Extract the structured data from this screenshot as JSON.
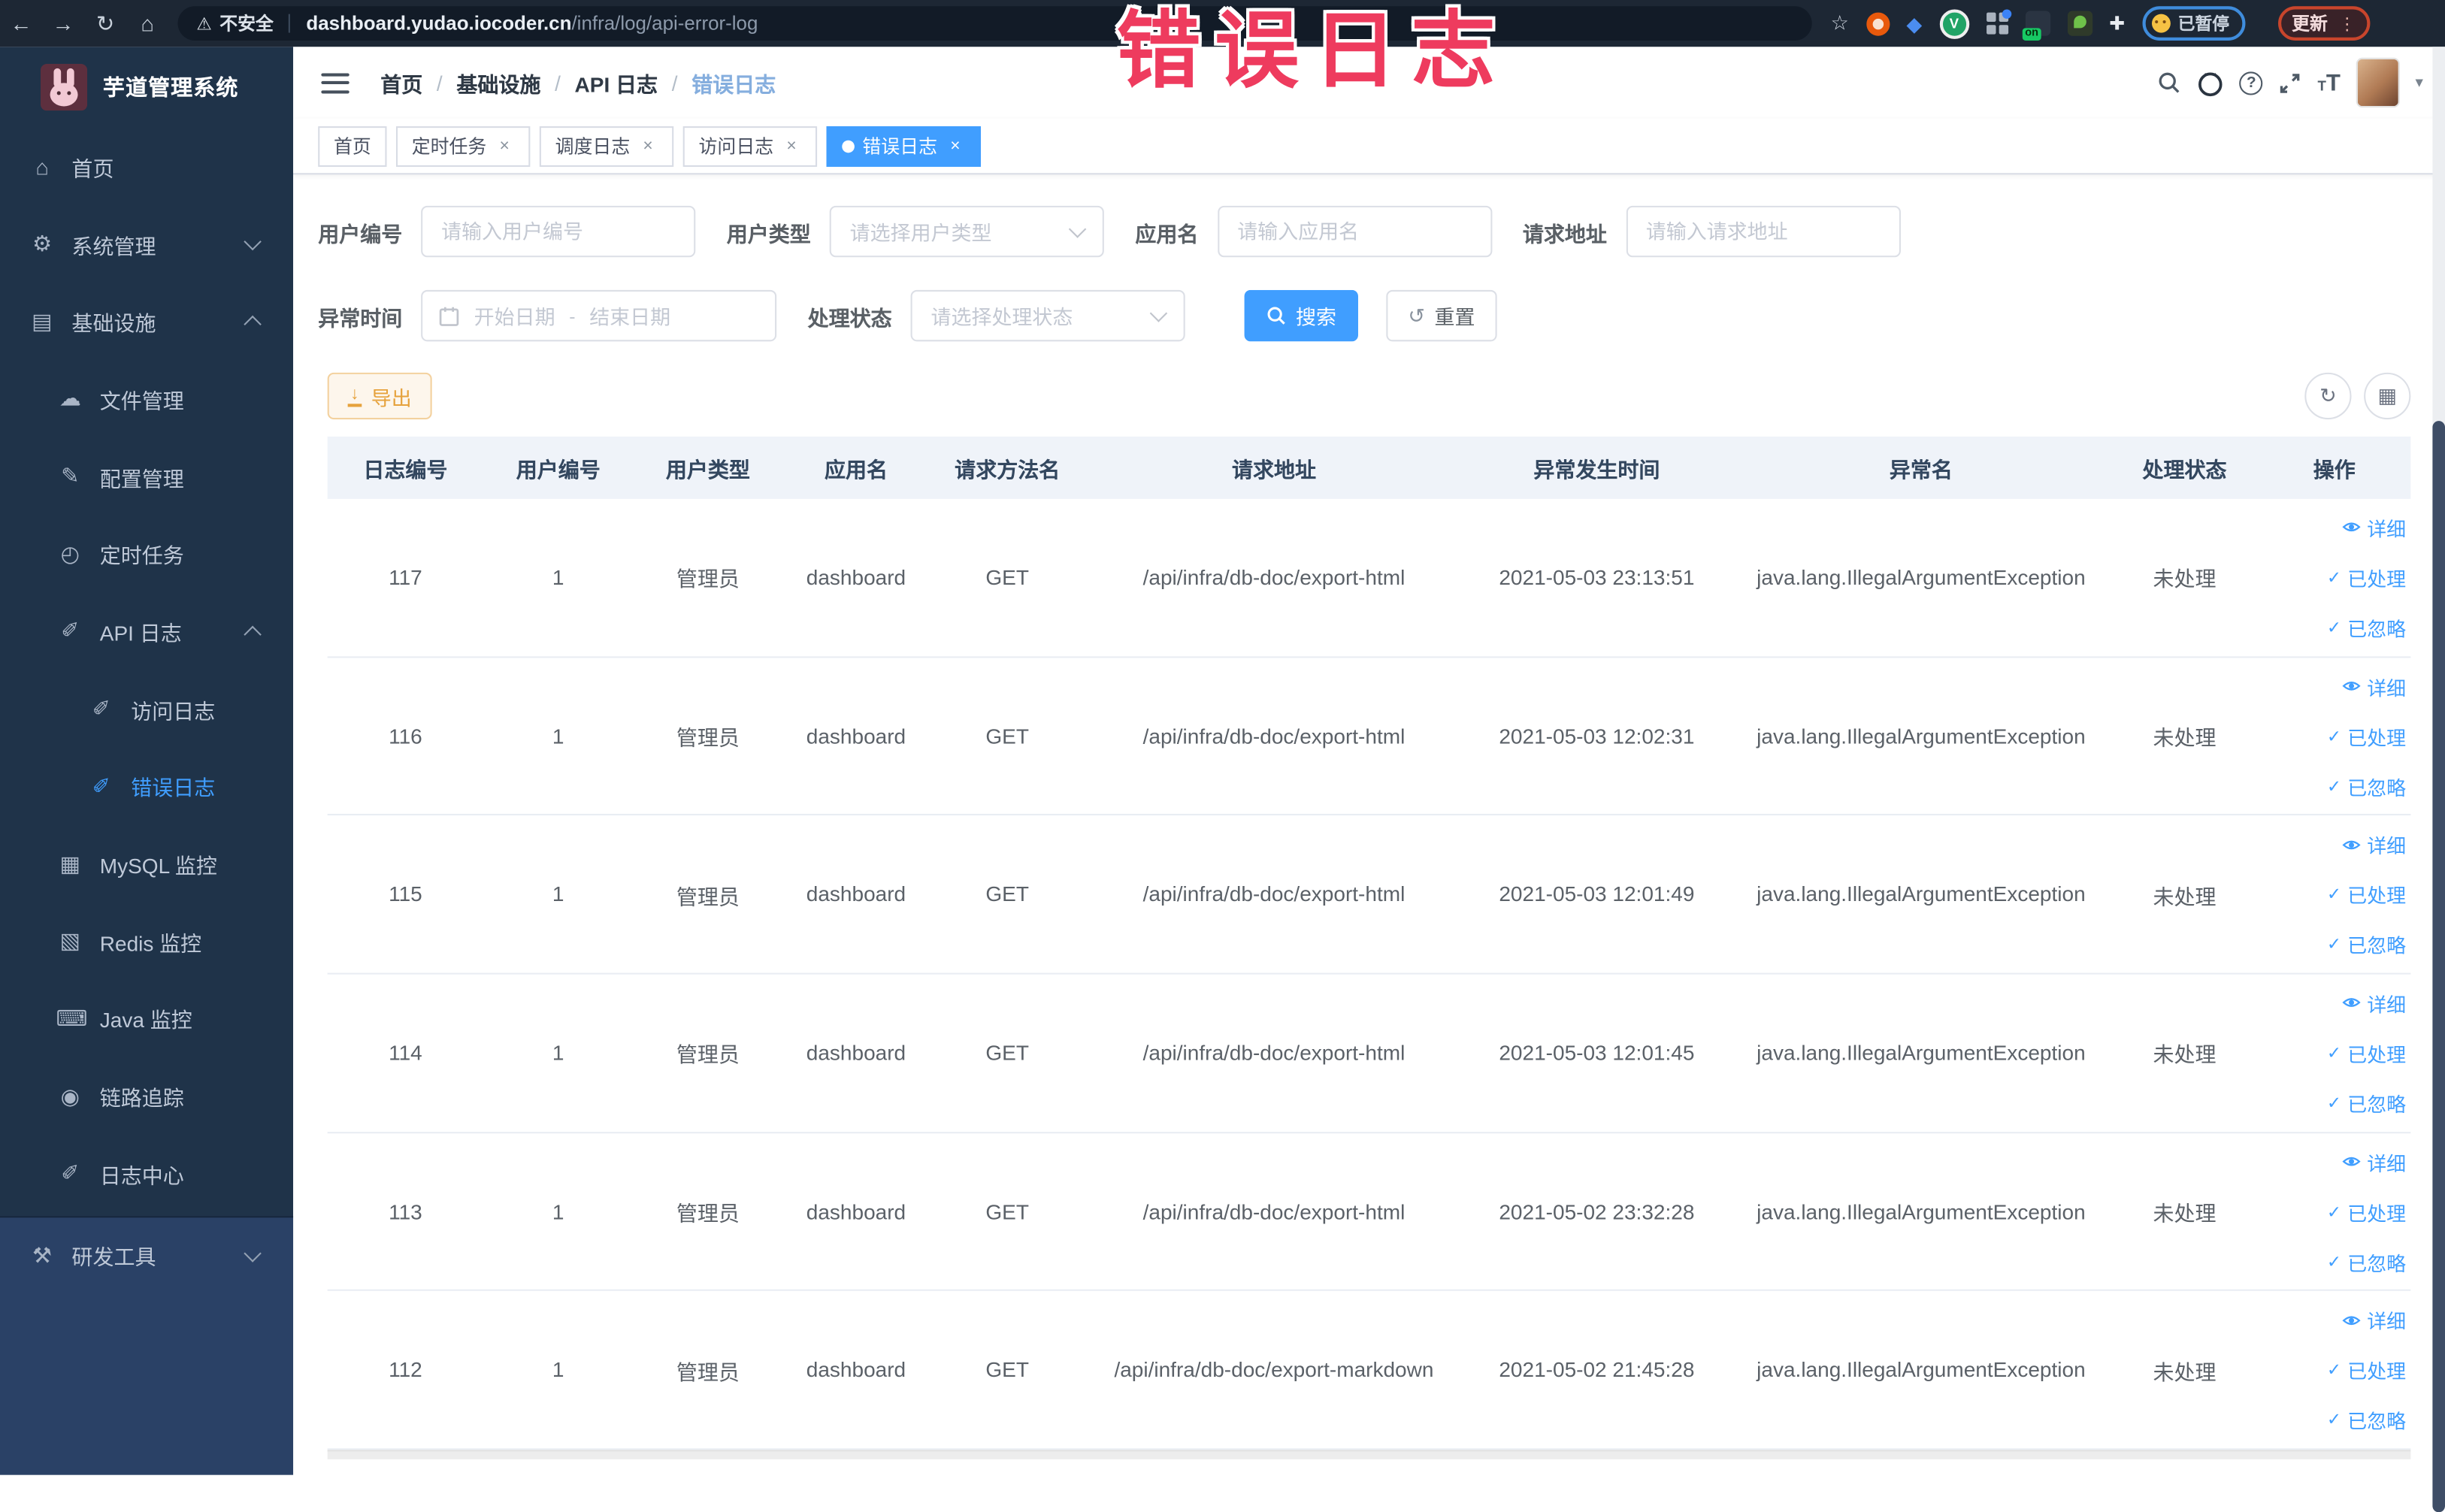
{
  "colors": {
    "accent": "#409eff",
    "annotation_red": "#ee3b5e",
    "warning_orange": "#e6a23c",
    "sidebar_bg": "#1f3349",
    "sidebar_bottom_bg": "#2a4166",
    "browser_bar_bg": "#1d2734"
  },
  "annotation": {
    "text": "错误日志"
  },
  "browser": {
    "security_label": "不安全",
    "url_domain": "dashboard.yudao.iocoder.cn",
    "url_path": "/infra/log/api-error-log",
    "on_badge": "on",
    "paused_label": "已暂停",
    "update_label": "更新"
  },
  "icons": {
    "back": "←",
    "forward": "→",
    "reload": "↻",
    "home": "⌂",
    "warning": "⚠",
    "star": "☆",
    "shield": "◆",
    "v_letter": "V",
    "puzzle": "✚",
    "dots": "⋮",
    "question": "?",
    "textsize_small": "T",
    "textsize_large": "T",
    "caret": "▾",
    "check": "✓",
    "refresh": "↻",
    "columns": "▦",
    "download": "↓",
    "reset": "↺",
    "close": "×"
  },
  "sidebar": {
    "title": "芋道管理系统",
    "items": [
      {
        "label": "首页",
        "glyph": "⌂"
      },
      {
        "label": "系统管理",
        "glyph": "⚙"
      },
      {
        "label": "基础设施",
        "glyph": "▤"
      },
      {
        "label": "文件管理",
        "glyph": "☁"
      },
      {
        "label": "配置管理",
        "glyph": "✎"
      },
      {
        "label": "定时任务",
        "glyph": "◴"
      },
      {
        "label": "API 日志",
        "glyph": "✐"
      },
      {
        "label": "访问日志",
        "glyph": "✐"
      },
      {
        "label": "错误日志",
        "glyph": "✐"
      },
      {
        "label": "MySQL 监控",
        "glyph": "▦"
      },
      {
        "label": "Redis 监控",
        "glyph": "▧"
      },
      {
        "label": "Java 监控",
        "glyph": "⌨"
      },
      {
        "label": "链路追踪",
        "glyph": "◉"
      },
      {
        "label": "日志中心",
        "glyph": "✐"
      },
      {
        "label": "研发工具",
        "glyph": "⚒"
      }
    ]
  },
  "breadcrumb": {
    "separator": "/",
    "items": [
      "首页",
      "基础设施",
      "API 日志",
      "错误日志"
    ]
  },
  "tabs": [
    {
      "label": "首页"
    },
    {
      "label": "定时任务"
    },
    {
      "label": "调度日志"
    },
    {
      "label": "访问日志"
    },
    {
      "label": "错误日志"
    }
  ],
  "filters": {
    "user_id_label": "用户编号",
    "user_id_placeholder": "请输入用户编号",
    "user_type_label": "用户类型",
    "user_type_placeholder": "请选择用户类型",
    "app_name_label": "应用名",
    "app_name_placeholder": "请输入应用名",
    "request_url_label": "请求地址",
    "request_url_placeholder": "请输入请求地址",
    "exception_time_label": "异常时间",
    "date_start_placeholder": "开始日期",
    "date_separator": "-",
    "date_end_placeholder": "结束日期",
    "process_status_label": "处理状态",
    "process_status_placeholder": "请选择处理状态",
    "search_label": "搜索",
    "reset_label": "重置"
  },
  "toolbar": {
    "export_label": "导出"
  },
  "table": {
    "columns": [
      "日志编号",
      "用户编号",
      "用户类型",
      "应用名",
      "请求方法名",
      "请求地址",
      "异常发生时间",
      "异常名",
      "处理状态",
      "操作"
    ],
    "actions": {
      "detail": "详细",
      "processed": "已处理",
      "ignored": "已忽略"
    },
    "rows": [
      {
        "id": "117",
        "user_id": "1",
        "user_type": "管理员",
        "app": "dashboard",
        "method": "GET",
        "url": "/api/infra/db-doc/export-html",
        "time": "2021-05-03 23:13:51",
        "exception": "java.lang.IllegalArgumentException",
        "status": "未处理"
      },
      {
        "id": "116",
        "user_id": "1",
        "user_type": "管理员",
        "app": "dashboard",
        "method": "GET",
        "url": "/api/infra/db-doc/export-html",
        "time": "2021-05-03 12:02:31",
        "exception": "java.lang.IllegalArgumentException",
        "status": "未处理"
      },
      {
        "id": "115",
        "user_id": "1",
        "user_type": "管理员",
        "app": "dashboard",
        "method": "GET",
        "url": "/api/infra/db-doc/export-html",
        "time": "2021-05-03 12:01:49",
        "exception": "java.lang.IllegalArgumentException",
        "status": "未处理"
      },
      {
        "id": "114",
        "user_id": "1",
        "user_type": "管理员",
        "app": "dashboard",
        "method": "GET",
        "url": "/api/infra/db-doc/export-html",
        "time": "2021-05-03 12:01:45",
        "exception": "java.lang.IllegalArgumentException",
        "status": "未处理"
      },
      {
        "id": "113",
        "user_id": "1",
        "user_type": "管理员",
        "app": "dashboard",
        "method": "GET",
        "url": "/api/infra/db-doc/export-html",
        "time": "2021-05-02 23:32:28",
        "exception": "java.lang.IllegalArgumentException",
        "status": "未处理"
      },
      {
        "id": "112",
        "user_id": "1",
        "user_type": "管理员",
        "app": "dashboard",
        "method": "GET",
        "url": "/api/infra/db-doc/export-markdown",
        "time": "2021-05-02 21:45:28",
        "exception": "java.lang.IllegalArgumentException",
        "status": "未处理"
      }
    ]
  }
}
